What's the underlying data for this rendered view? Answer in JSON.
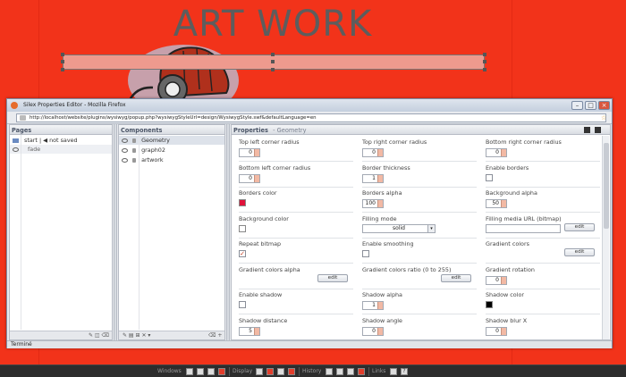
{
  "stage": {
    "title": "ART WORK"
  },
  "window": {
    "title": "Silex Properties Editor - Mozilla Firefox",
    "url": "http://localhost/website/plugins/wysiwyg/popup.php?wysiwygStyleUrl=design/WysiwygStyle.swf&defaultLanguage=en",
    "status": "Terminé"
  },
  "pages": {
    "header": "Pages",
    "items": [
      {
        "label": "start | ◀ not saved"
      },
      {
        "label": "fade"
      }
    ]
  },
  "components": {
    "header": "Components",
    "items": [
      {
        "label": "Geometry"
      },
      {
        "label": "graph02"
      },
      {
        "label": "artwork"
      }
    ]
  },
  "properties": {
    "header": "Properties",
    "subheader": "- Geometry",
    "fields": [
      {
        "label": "Top left corner radius",
        "kind": "stepper",
        "value": "0"
      },
      {
        "label": "Top right corner radius",
        "kind": "stepper",
        "value": "0"
      },
      {
        "label": "Bottom right corner radius",
        "kind": "stepper",
        "value": "0"
      },
      {
        "label": "Bottom left corner radius",
        "kind": "stepper",
        "value": "0"
      },
      {
        "label": "Border thickness",
        "kind": "stepper",
        "value": "1"
      },
      {
        "label": "Enable borders",
        "kind": "checkbox",
        "checked": false
      },
      {
        "label": "Borders color",
        "kind": "color",
        "color": "#e0123a"
      },
      {
        "label": "Borders alpha",
        "kind": "stepper",
        "value": "100"
      },
      {
        "label": "Background alpha",
        "kind": "stepper",
        "value": "50"
      },
      {
        "label": "Background color",
        "kind": "color",
        "color": "#ffffff"
      },
      {
        "label": "Filling mode",
        "kind": "select",
        "value": "solid"
      },
      {
        "label": "Filling media URL (bitmap)",
        "kind": "text-edit",
        "button": "edit"
      },
      {
        "label": "Repeat bitmap",
        "kind": "checkbox",
        "checked": true
      },
      {
        "label": "Enable smoothing",
        "kind": "checkbox",
        "checked": false
      },
      {
        "label": "Gradient colors",
        "kind": "button",
        "button": "edit"
      },
      {
        "label": "Gradient colors alpha",
        "kind": "button",
        "button": "edit"
      },
      {
        "label": "Gradient colors ratio (0 to 255)",
        "kind": "button",
        "button": "edit"
      },
      {
        "label": "Gradient rotation",
        "kind": "stepper",
        "value": "0"
      },
      {
        "label": "Enable shadow",
        "kind": "checkbox",
        "checked": false
      },
      {
        "label": "Shadow alpha",
        "kind": "stepper",
        "value": "1"
      },
      {
        "label": "Shadow color",
        "kind": "color",
        "color": "#000000"
      },
      {
        "label": "Shadow distance",
        "kind": "stepper",
        "value": "5"
      },
      {
        "label": "Shadow angle",
        "kind": "stepper",
        "value": "0"
      },
      {
        "label": "Shadow blur X",
        "kind": "stepper",
        "value": "0"
      }
    ]
  },
  "taskbar": {
    "windows_label": "Windows",
    "display_label": "Display",
    "history_label": "History",
    "links_label": "Links"
  }
}
